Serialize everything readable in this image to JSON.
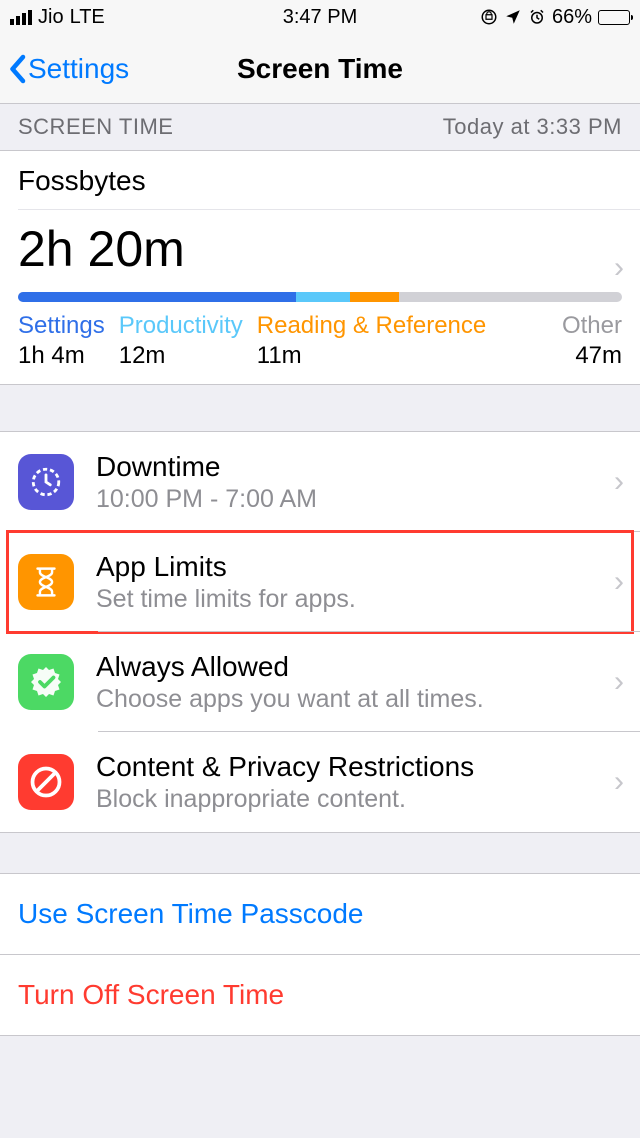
{
  "status": {
    "carrier": "Jio",
    "network": "LTE",
    "time": "3:47 PM",
    "battery_pct": "66%",
    "battery_fill_pct": 66
  },
  "nav": {
    "back_label": "Settings",
    "title": "Screen Time"
  },
  "section": {
    "header_left": "SCREEN TIME",
    "header_right": "Today at 3:33 PM"
  },
  "summary": {
    "device_name": "Fossbytes",
    "total": "2h 20m",
    "categories": [
      {
        "name": "Settings",
        "duration": "1h 4m",
        "color": "settings"
      },
      {
        "name": "Productivity",
        "duration": "12m",
        "color": "productivity"
      },
      {
        "name": "Reading & Reference",
        "duration": "11m",
        "color": "reading"
      },
      {
        "name": "Other",
        "duration": "47m",
        "color": "other"
      }
    ]
  },
  "rows": {
    "downtime": {
      "title": "Downtime",
      "sub": "10:00 PM - 7:00 AM"
    },
    "applimits": {
      "title": "App Limits",
      "sub": "Set time limits for apps."
    },
    "allowed": {
      "title": "Always Allowed",
      "sub": "Choose apps you want at all times."
    },
    "restrictions": {
      "title": "Content & Privacy Restrictions",
      "sub": "Block inappropriate content."
    }
  },
  "actions": {
    "passcode": "Use Screen Time Passcode",
    "turn_off": "Turn Off Screen Time"
  }
}
